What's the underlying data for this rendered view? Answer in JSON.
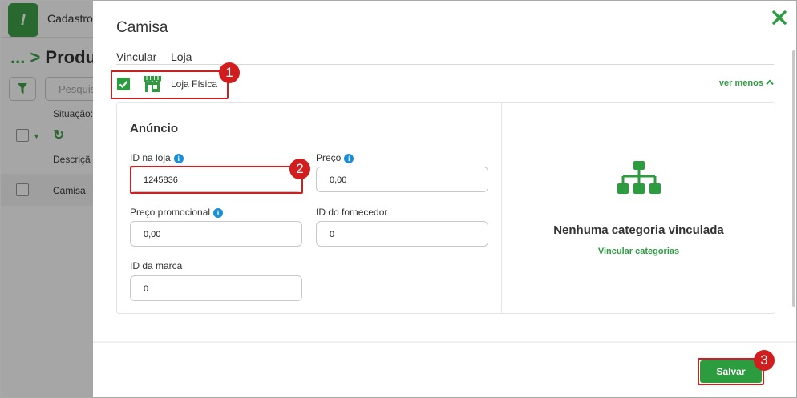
{
  "background": {
    "topbar": {
      "menu_label": "Cadastros"
    },
    "page_title_prefix": "... >",
    "page_title": "Produt",
    "search_placeholder": "Pesquis",
    "filter_label": "Situação:",
    "description_label": "Descriçã",
    "rows": [
      {
        "label": "Camisa"
      }
    ]
  },
  "modal": {
    "title": "Camisa",
    "tabs": [
      {
        "label": "Vincular"
      },
      {
        "label": "Loja"
      }
    ],
    "store": {
      "label": "Loja Física",
      "checked": true,
      "toggle_label": "ver menos"
    },
    "section_title": "Anúncio",
    "fields": {
      "id_na_loja": {
        "label": "ID na loja",
        "value": "1245836"
      },
      "preco": {
        "label": "Preço",
        "value": "0,00"
      },
      "preco_promocional": {
        "label": "Preço promocional",
        "value": "0,00"
      },
      "id_fornecedor": {
        "label": "ID do fornecedor",
        "value": "0"
      },
      "id_marca": {
        "label": "ID da marca",
        "value": "0"
      }
    },
    "category": {
      "empty_title": "Nenhuma categoria vinculada",
      "link_label": "Vincular categorias"
    },
    "save_label": "Salvar"
  },
  "annotations": [
    "1",
    "2",
    "3"
  ],
  "colors": {
    "accent": "#2c9d3f",
    "highlight": "#cc1f1f",
    "info": "#1a8fd6"
  },
  "icons": [
    "close-icon",
    "store-icon",
    "info-icon",
    "sitemap-icon",
    "filter-icon",
    "refresh-icon",
    "check-icon",
    "chevron-up-icon"
  ]
}
